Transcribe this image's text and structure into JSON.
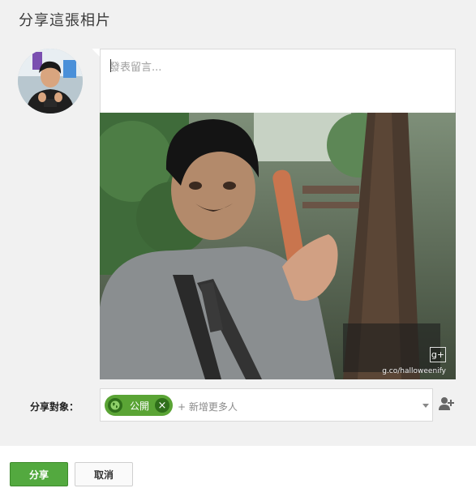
{
  "dialog": {
    "title": "分享這張相片"
  },
  "compose": {
    "placeholder": "發表留言..."
  },
  "photo": {
    "badge_icon": "google-plus-icon",
    "watermark": "g.co/halloweenify"
  },
  "share_to": {
    "label": "分享對象：",
    "chip_label": "公開",
    "chip_icon": "globe-icon",
    "add_more": "+ 新增更多人"
  },
  "footer": {
    "share_label": "分享",
    "cancel_label": "取消"
  },
  "colors": {
    "accent_green": "#53a93f",
    "chip_green": "#5aa435",
    "chip_dark": "#2f6f1a"
  }
}
